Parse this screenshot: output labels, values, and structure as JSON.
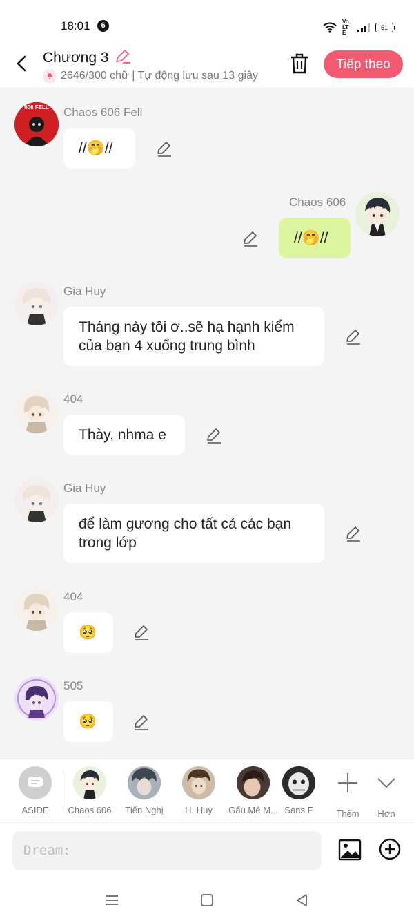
{
  "status_bar": {
    "time": "18:01",
    "notification_count": "6",
    "battery": "51",
    "network_label": "Vo LTE"
  },
  "header": {
    "chapter_title": "Chương 3",
    "word_count": "2646/300 chữ | Tự động lưu sau 13 giây",
    "next_label": "Tiếp theo"
  },
  "messages": [
    {
      "sender": "Chaos 606 Fell",
      "text": "//🤭//"
    },
    {
      "sender": "Chaos 606",
      "text": "//🤭//"
    },
    {
      "sender": "Gia Huy",
      "text": "Tháng này tôi ơ..sẽ hạ hạnh kiểm của bạn 4 xuống trung bình"
    },
    {
      "sender": "404",
      "text": "Thày, nhma e"
    },
    {
      "sender": "Gia Huy",
      "text": "để làm gương cho tất cả các bạn trong lớp"
    },
    {
      "sender": "404",
      "text": "🥺"
    },
    {
      "sender": "505",
      "text": "🥺"
    }
  ],
  "avatar_tag": "606 FELL",
  "characters": [
    {
      "name": "ASIDE"
    },
    {
      "name": "Chaos 606"
    },
    {
      "name": "Tiến Nghị"
    },
    {
      "name": "H. Huy"
    },
    {
      "name": "Gấu Mê M..."
    },
    {
      "name": "Sans F"
    }
  ],
  "tray_actions": {
    "add_label": "Thêm",
    "more_label": "Hơn"
  },
  "composer": {
    "placeholder": "Dream:"
  },
  "colors": {
    "accent": "#f25a72",
    "my_bubble": "#def5a0",
    "background": "#f4f4f4"
  },
  "icons": [
    "back-arrow-icon",
    "pencil-icon",
    "trash-icon",
    "image-icon",
    "plus-circle-icon",
    "menu-icon",
    "home-square-icon",
    "back-triangle-icon"
  ]
}
